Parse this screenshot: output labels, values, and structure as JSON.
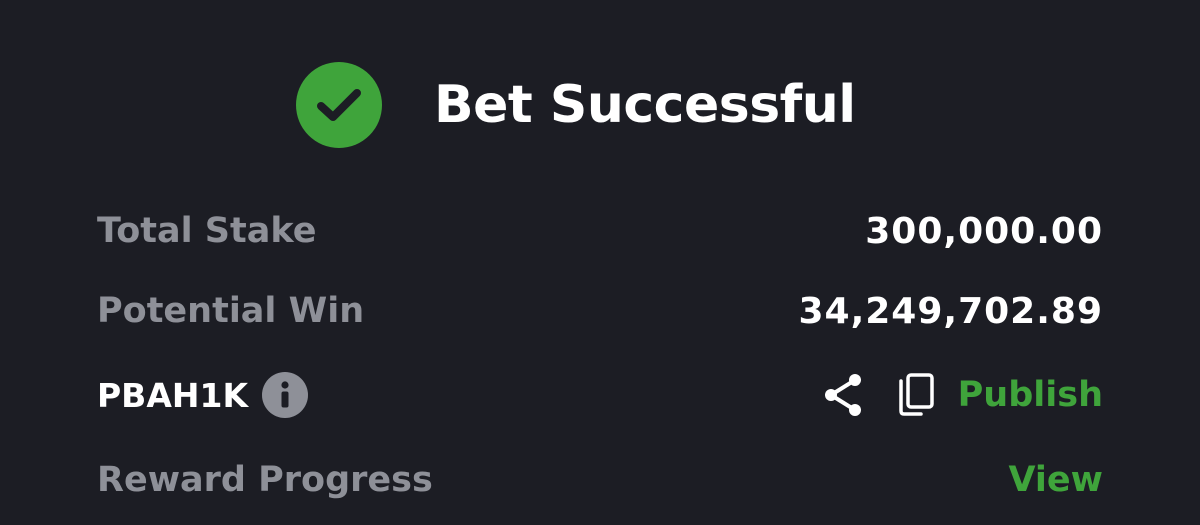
{
  "header": {
    "icon": "check-circle-icon",
    "title": "Bet Successful"
  },
  "summary": {
    "total_stake": {
      "label": "Total Stake",
      "value": "300,000.00"
    },
    "potential_win": {
      "label": "Potential Win",
      "value": "34,249,702.89"
    },
    "booking": {
      "code": "PBAH1K",
      "info_icon": "info-icon",
      "share_icon": "share-icon",
      "copy_icon": "copy-icon",
      "publish_label": "Publish"
    },
    "reward_progress": {
      "label": "Reward Progress",
      "view_label": "View"
    }
  },
  "colors": {
    "background": "#1c1d24",
    "accent_green": "#3fa43b",
    "label_gray": "#8e9098",
    "text_white": "#ffffff"
  }
}
